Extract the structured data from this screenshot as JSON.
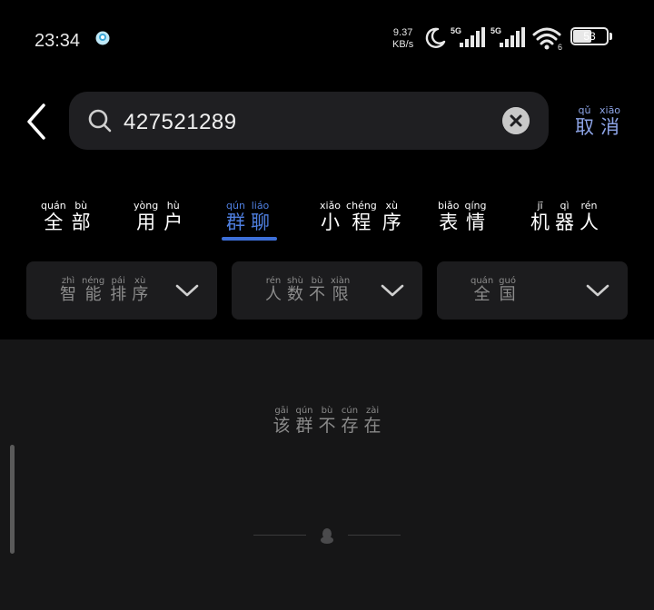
{
  "status_bar": {
    "time": "23:34",
    "net_speed_value": "9.37",
    "net_speed_unit": "KB/s",
    "signal_1_label": "5G",
    "signal_2_label": "5G",
    "wifi_badge": "6",
    "battery_level": "53",
    "icons": [
      "app-notification-icon",
      "moon-icon",
      "signal-icon",
      "wifi-icon",
      "battery-icon"
    ]
  },
  "search": {
    "query": "427521289",
    "cancel": [
      {
        "py": "qǔ",
        "hz": "取"
      },
      {
        "py": "xiāo",
        "hz": "消"
      }
    ]
  },
  "tabs": [
    {
      "id": "all",
      "chars": [
        {
          "py": "quán",
          "hz": "全"
        },
        {
          "py": "bù",
          "hz": "部"
        }
      ],
      "active": false
    },
    {
      "id": "users",
      "chars": [
        {
          "py": "yòng",
          "hz": "用"
        },
        {
          "py": "hù",
          "hz": "户"
        }
      ],
      "active": false
    },
    {
      "id": "groups",
      "chars": [
        {
          "py": "qún",
          "hz": "群"
        },
        {
          "py": "liáo",
          "hz": "聊"
        }
      ],
      "active": true
    },
    {
      "id": "mini-programs",
      "chars": [
        {
          "py": "xiǎo",
          "hz": "小"
        },
        {
          "py": "chéng",
          "hz": "程"
        },
        {
          "py": "xù",
          "hz": "序"
        }
      ],
      "active": false
    },
    {
      "id": "stickers",
      "chars": [
        {
          "py": "biǎo",
          "hz": "表"
        },
        {
          "py": "qíng",
          "hz": "情"
        }
      ],
      "active": false
    },
    {
      "id": "robots",
      "chars": [
        {
          "py": "jī",
          "hz": "机"
        },
        {
          "py": "qì",
          "hz": "器"
        },
        {
          "py": "rén",
          "hz": "人"
        }
      ],
      "active": false
    }
  ],
  "filters": [
    {
      "id": "sort",
      "chars": [
        {
          "py": "zhì",
          "hz": "智"
        },
        {
          "py": "néng",
          "hz": "能"
        },
        {
          "py": "pái",
          "hz": "排"
        },
        {
          "py": "xù",
          "hz": "序"
        }
      ]
    },
    {
      "id": "size",
      "chars": [
        {
          "py": "rén",
          "hz": "人"
        },
        {
          "py": "shù",
          "hz": "数"
        },
        {
          "py": "bù",
          "hz": "不"
        },
        {
          "py": "xiàn",
          "hz": "限"
        }
      ]
    },
    {
      "id": "region",
      "chars": [
        {
          "py": "quán",
          "hz": "全"
        },
        {
          "py": "guó",
          "hz": "国"
        }
      ]
    }
  ],
  "empty_state": [
    {
      "py": "gāi",
      "hz": "该"
    },
    {
      "py": "qún",
      "hz": "群"
    },
    {
      "py": "bù",
      "hz": "不"
    },
    {
      "py": "cún",
      "hz": "存"
    },
    {
      "py": "zài",
      "hz": "在"
    }
  ],
  "colors": {
    "accent": "#4f7fe0",
    "cancel": "#8da4e6",
    "background": "#000000",
    "panel": "#1c1c1e",
    "results_bg": "#161617"
  }
}
